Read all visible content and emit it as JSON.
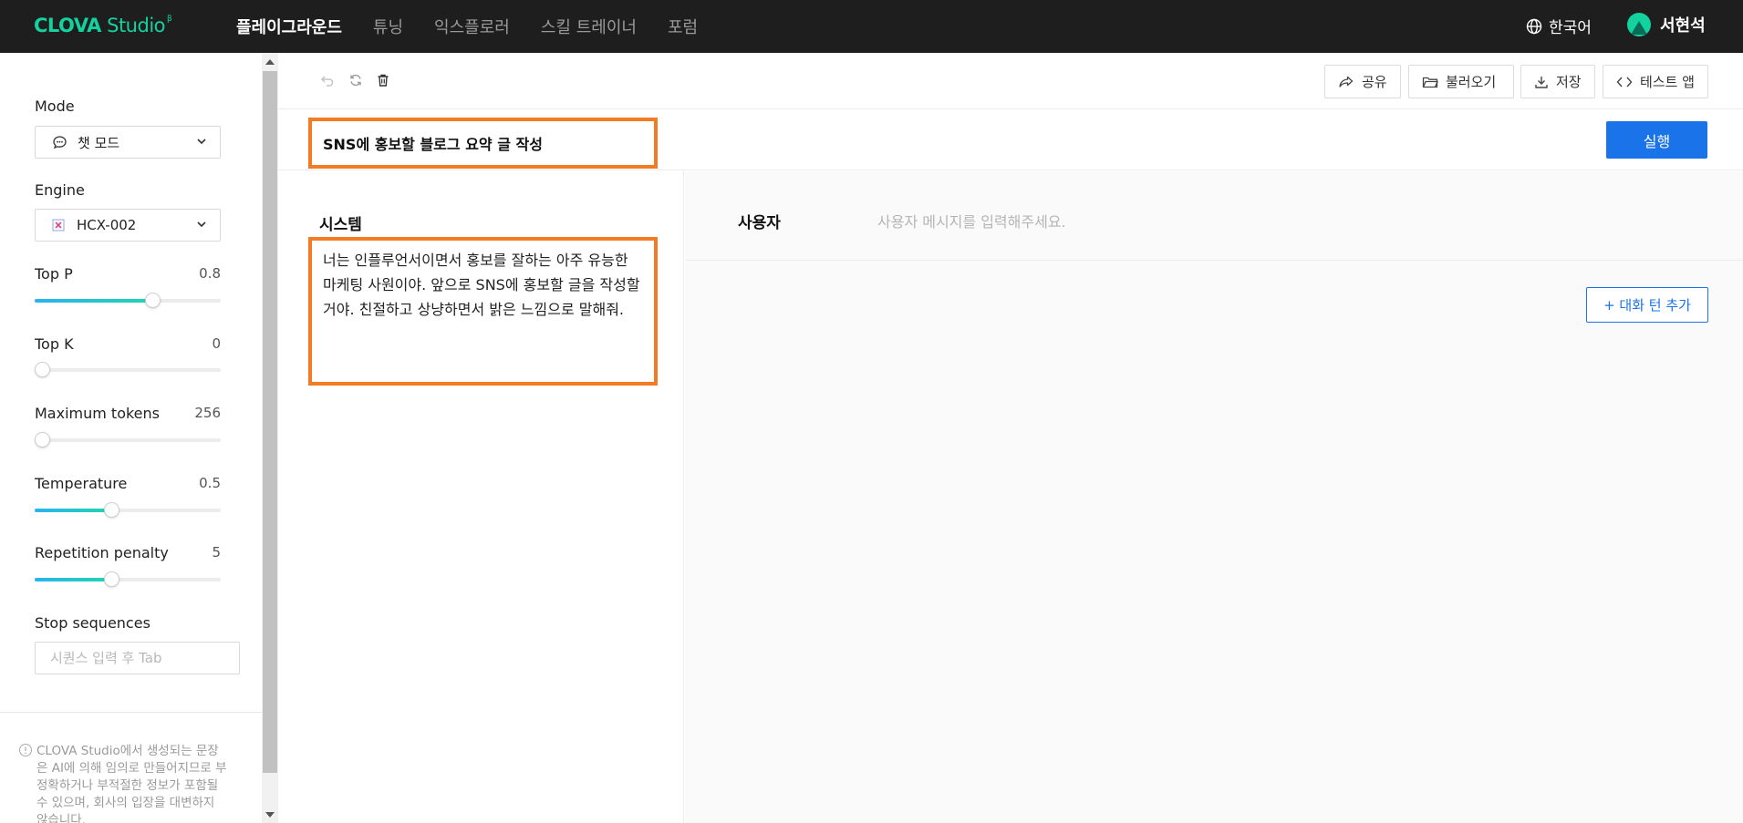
{
  "header": {
    "logo_brand": "CLOVA",
    "logo_product": "Studio",
    "logo_badge": "β",
    "nav": [
      {
        "label": "플레이그라운드",
        "active": true
      },
      {
        "label": "튜닝",
        "active": false
      },
      {
        "label": "익스플로러",
        "active": false
      },
      {
        "label": "스킬 트레이너",
        "active": false
      },
      {
        "label": "포럼",
        "active": false
      }
    ],
    "language": "한국어",
    "user_name": "서현석"
  },
  "sidebar": {
    "mode": {
      "label": "Mode",
      "value": "챗 모드"
    },
    "engine": {
      "label": "Engine",
      "value": "HCX-002"
    },
    "params": [
      {
        "label": "Top P",
        "value": "0.8",
        "fraction": 0.63
      },
      {
        "label": "Top K",
        "value": "0",
        "fraction": 0.0
      },
      {
        "label": "Maximum tokens",
        "value": "256",
        "fraction": 0.04
      },
      {
        "label": "Temperature",
        "value": "0.5",
        "fraction": 0.41
      },
      {
        "label": "Repetition penalty",
        "value": "5",
        "fraction": 0.41
      }
    ],
    "stop_sequences": {
      "label": "Stop sequences",
      "placeholder": "시퀀스 입력 후 Tab"
    },
    "disclaimer": "CLOVA Studio에서 생성되는 문장은 AI에 의해 임의로 만들어지므로 부정확하거나 부적절한 정보가 포함될 수 있으며, 회사의 입장을 대변하지 않습니다."
  },
  "toolbar": {
    "share": "공유",
    "load": "불러오기",
    "save": "저장",
    "test_app": "테스트 앱"
  },
  "prompt": {
    "title": "SNS에 홍보할 블로그 요약 글 작성",
    "run_label": "실행"
  },
  "system": {
    "label": "시스템",
    "text": "너는 인플루언서이면서 홍보를 잘하는 아주 유능한 마케팅 사원이야. 앞으로 SNS에 홍보할 글을 작성할거야. 친절하고 상냥하면서 밝은 느낌으로 말해줘."
  },
  "chat": {
    "user_label": "사용자",
    "user_placeholder": "사용자 메시지를 입력해주세요.",
    "add_turn_label": "+ 대화 턴 추가"
  },
  "colors": {
    "accent": "#1a73e8",
    "brand": "#13d2a0",
    "highlight": "#f37b23"
  }
}
